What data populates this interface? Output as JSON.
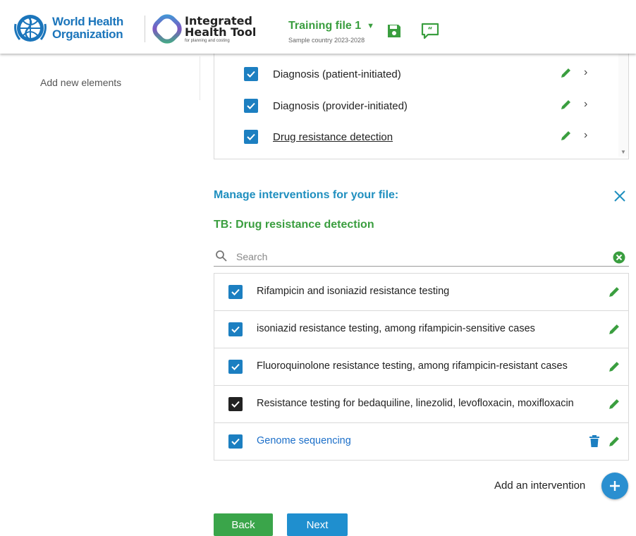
{
  "header": {
    "who_line1": "World Health",
    "who_line2": "Organization",
    "iht_line1": "Integrated",
    "iht_line2": "Health Tool",
    "iht_sub": "for planning and costing",
    "file_title": "Training file 1",
    "file_sub": "Sample country 2023-2028"
  },
  "sidebar": {
    "add_elements": "Add new elements"
  },
  "top_list": {
    "items": [
      {
        "label": "Diagnosis (patient-initiated)"
      },
      {
        "label": "Diagnosis (provider-initiated)"
      },
      {
        "label": "Drug resistance detection"
      }
    ]
  },
  "manage": {
    "title": "Manage interventions for your file:",
    "subheading": "TB: Drug resistance detection",
    "search_placeholder": "Search"
  },
  "interventions": [
    {
      "label": "Rifampicin and isoniazid resistance testing",
      "checked": true
    },
    {
      "label": "isoniazid resistance testing, among rifampicin-sensitive cases",
      "checked": true
    },
    {
      "label": "Fluoroquinolone resistance testing, among rifampicin-resistant cases",
      "checked": true
    },
    {
      "label": "Resistance testing for bedaquiline, linezolid, levofloxacin, moxifloxacin",
      "checked": true
    },
    {
      "label": "Genome sequencing",
      "checked": true
    }
  ],
  "footer": {
    "add_intervention": "Add an intervention",
    "back": "Back",
    "next": "Next"
  },
  "colors": {
    "accent_blue": "#1c7fc1",
    "accent_green": "#3a9e3f"
  }
}
